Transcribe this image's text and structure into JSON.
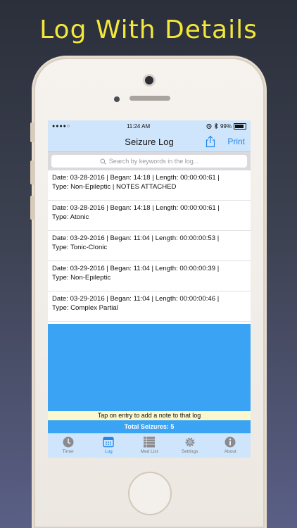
{
  "promo": {
    "headline": "Log With Details"
  },
  "status_bar": {
    "signal_dots": "●●●●○",
    "time": "11:24 AM",
    "battery": "99%"
  },
  "nav": {
    "title": "Seizure Log",
    "print_label": "Print"
  },
  "search": {
    "placeholder": "Search by keywords in the log..."
  },
  "entries": [
    {
      "line1": "Date: 03-28-2016 | Began: 14:18 | Length: 00:00:00:61 |",
      "line2": "Type: Non-Epileptic  | NOTES ATTACHED"
    },
    {
      "line1": "Date: 03-28-2016 | Began: 14:18 | Length: 00:00:00:61 |",
      "line2": "Type: Atonic"
    },
    {
      "line1": "Date: 03-29-2016 | Began: 11:04 | Length: 00:00:00:53 |",
      "line2": "Type: Tonic-Clonic"
    },
    {
      "line1": "Date: 03-29-2016 | Began: 11:04 | Length: 00:00:00:39 |",
      "line2": "Type: Non-Epileptic"
    },
    {
      "line1": "Date: 03-29-2016 | Began: 11:04 | Length: 00:00:00:46 |",
      "line2": "Type: Complex Partial"
    }
  ],
  "footer": {
    "hint": "Tap on entry to add a note to that log",
    "total": "Total Seizures: 5"
  },
  "tabs": [
    {
      "label": "Timer",
      "icon": "clock-icon",
      "active": false
    },
    {
      "label": "Log",
      "icon": "calendar-icon",
      "active": true
    },
    {
      "label": "Med List",
      "icon": "list-icon",
      "active": false
    },
    {
      "label": "Settings",
      "icon": "gear-icon",
      "active": false
    },
    {
      "label": "About",
      "icon": "info-icon",
      "active": false
    }
  ],
  "colors": {
    "headline": "#f3e73a",
    "bar_background": "#cfe5fb",
    "accent_blue": "#1f86f0",
    "list_fill_blue": "#3aa3f4",
    "hint_yellow": "#fbf8cd"
  }
}
